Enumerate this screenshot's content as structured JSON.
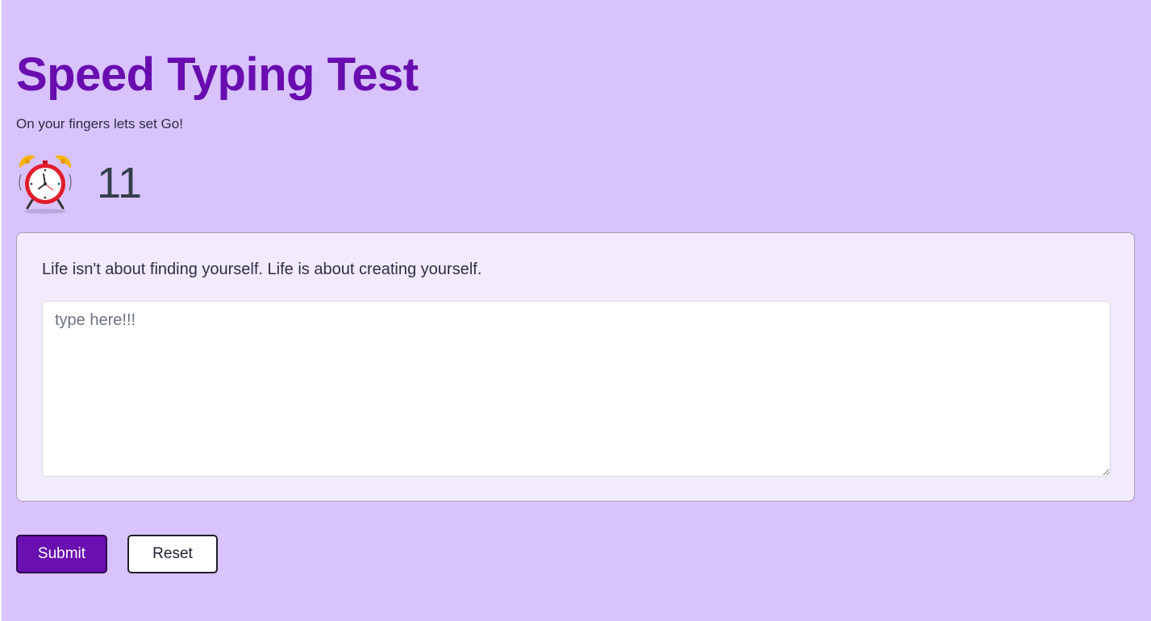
{
  "header": {
    "title": "Speed Typing Test",
    "subtitle": "On your fingers lets set Go!"
  },
  "timer": {
    "icon": "alarm-clock-icon",
    "value": "11"
  },
  "quote": {
    "text": "Life isn't about finding yourself. Life is about creating yourself."
  },
  "input": {
    "placeholder": "type here!!!",
    "value": ""
  },
  "buttons": {
    "submit_label": "Submit",
    "reset_label": "Reset"
  },
  "colors": {
    "background": "#d8c3fe",
    "title": "#690cb0",
    "card": "#f2ebfe",
    "submit": "#6a0fb1",
    "clock_frame": "#e11d2b",
    "clock_bells": "#f5b400"
  }
}
